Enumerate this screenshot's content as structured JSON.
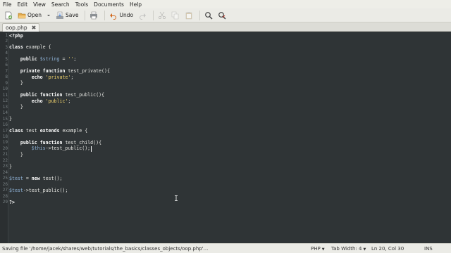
{
  "menu": [
    "File",
    "Edit",
    "View",
    "Search",
    "Tools",
    "Documents",
    "Help"
  ],
  "toolbar": {
    "new_icon": "new-document-icon",
    "open_label": "Open",
    "save_label": "Save",
    "undo_label": "Undo"
  },
  "tab": {
    "label": "oop.php",
    "close_icon": "close-icon"
  },
  "editor": {
    "line_numbers": [
      "1",
      "2",
      "3",
      "4",
      "5",
      "6",
      "7",
      "8",
      "9",
      "10",
      "11",
      "12",
      "13",
      "14",
      "15",
      "16",
      "17",
      "18",
      "19",
      "20",
      "21",
      "22",
      "23",
      "24",
      "25",
      "26",
      "27",
      "28",
      "29"
    ],
    "cursor": "Ln 20, Col 30"
  },
  "status": {
    "message": "Saving file '/home/jacek/shares/web/tutorials/the_basics/classes_objects/oop.php'...",
    "language": "PHP",
    "tab_width": "Tab Width: 4",
    "position": "Ln 20, Col 30",
    "mode": "INS"
  },
  "colors": {
    "editor_bg": "#2f3436",
    "keyword": "#ffffff",
    "variable": "#8fb3d8",
    "string": "#f5d76e"
  }
}
